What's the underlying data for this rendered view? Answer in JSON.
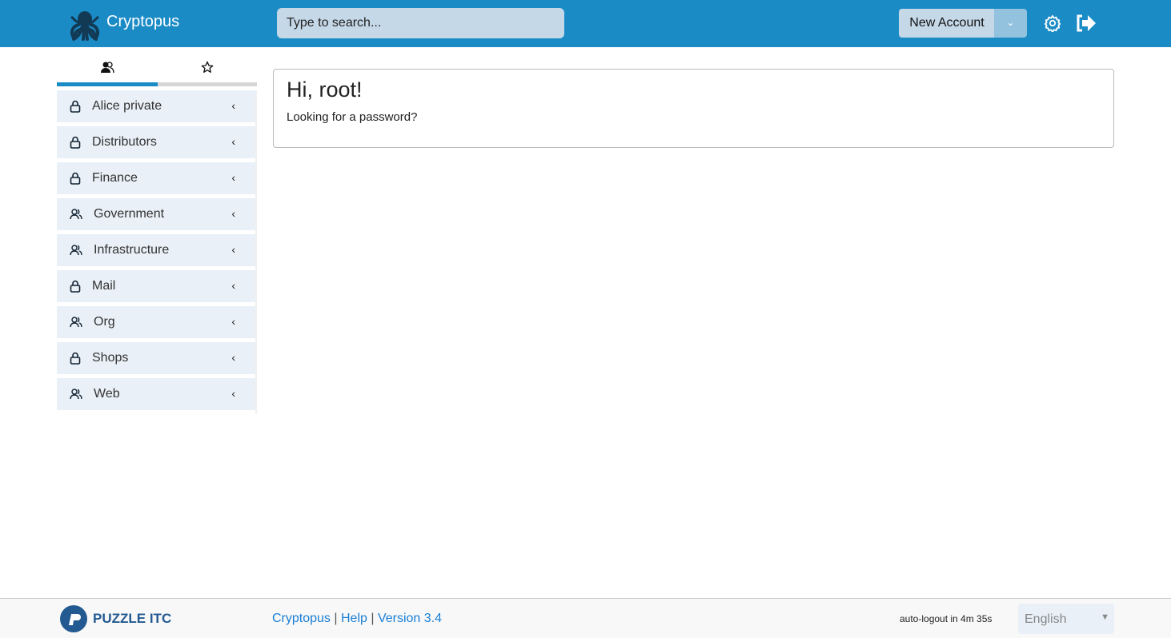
{
  "header": {
    "brand": "Cryptopus",
    "search_placeholder": "Type to search...",
    "new_account": "New Account",
    "icons": [
      "octopus-logo",
      "chevron-down-icon",
      "gear-icon",
      "logout-icon"
    ],
    "accent": "#1b8bc6"
  },
  "tabs": [
    {
      "icon": "teams-icon",
      "active": true
    },
    {
      "icon": "star-icon",
      "active": false
    }
  ],
  "sidebar": {
    "items": [
      {
        "label": "Alice private",
        "icon": "lock"
      },
      {
        "label": "Distributors",
        "icon": "lock"
      },
      {
        "label": "Finance",
        "icon": "lock"
      },
      {
        "label": "Government",
        "icon": "users"
      },
      {
        "label": "Infrastructure",
        "icon": "users"
      },
      {
        "label": "Mail",
        "icon": "lock"
      },
      {
        "label": "Org",
        "icon": "users"
      },
      {
        "label": "Shops",
        "icon": "lock"
      },
      {
        "label": "Web",
        "icon": "users"
      }
    ]
  },
  "main": {
    "greeting": "Hi, root!",
    "subtitle": "Looking for a password?"
  },
  "footer": {
    "company": "PUZZLE ITC",
    "link_cryptopus": "Cryptopus",
    "sep": "|",
    "link_help": "Help",
    "version": "Version 3.4",
    "autologout": "auto-logout in 4m 35s",
    "language": "English"
  }
}
